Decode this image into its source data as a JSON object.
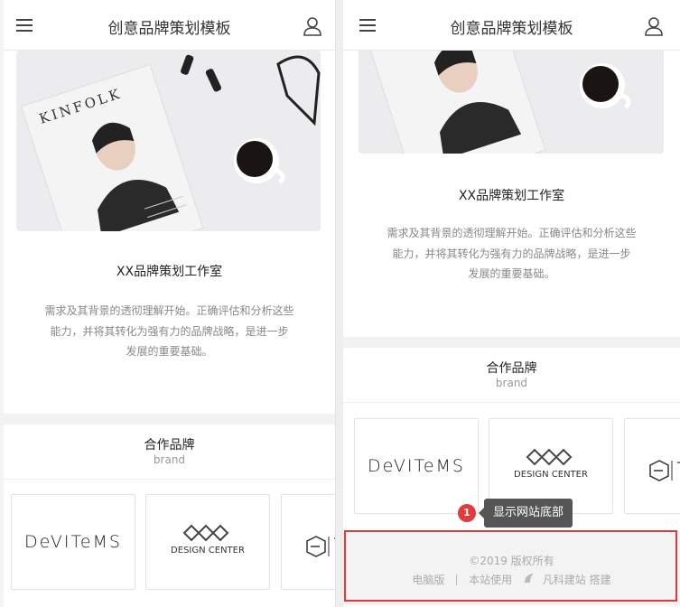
{
  "header": {
    "title": "创意品牌策划模板"
  },
  "hero": {
    "magazine_text": "KINFOLK"
  },
  "studio": {
    "name": "XX品牌策划工作室",
    "desc_lines": [
      "需求及其背景的透彻理解开始。正确评估和分析这些",
      "能力，并将其转化为强有力的品牌战略，是进一步",
      "发展的重要基础。"
    ]
  },
  "brand": {
    "title": "合作品牌",
    "subtitle": "brand",
    "logos": [
      "DeVITeMS",
      "DESIGN CENTER",
      "T"
    ]
  },
  "footer": {
    "copyright": "©2019 版权所有",
    "links": [
      "电脑版",
      "本站使用",
      "凡科建站 搭建"
    ]
  },
  "tooltip": {
    "badge": "1",
    "text": "显示网站底部"
  },
  "colors": {
    "accent": "#e0393b",
    "tooltip_bg": "#555555"
  }
}
